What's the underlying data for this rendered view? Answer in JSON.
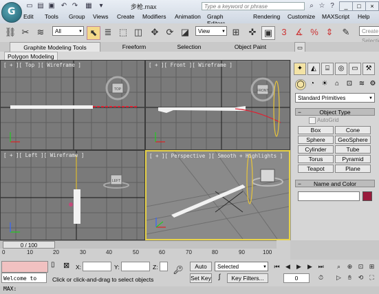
{
  "title_bar": {
    "logo_glyph": "G",
    "doc_title": "步枪.max",
    "search_placeholder": "Type a keyword or phrase",
    "quick_access": [
      "new-icon",
      "open-icon",
      "save-icon",
      "undo-icon",
      "redo-icon",
      "dropdown-icon"
    ],
    "right_icons": [
      "binoculars-icon",
      "star-icon",
      "help-icon"
    ],
    "window_buttons": [
      "_",
      "□",
      "×"
    ]
  },
  "menu": [
    "Edit",
    "Tools",
    "Group",
    "Views",
    "Create",
    "Modifiers",
    "Animation",
    "Graph Editors",
    "Rendering",
    "Customize",
    "MAXScript",
    "Help"
  ],
  "toolbar": {
    "selection_filter": "All",
    "coord_system": "View",
    "named_selection": "Create Selection Se"
  },
  "ribbon": {
    "tabs": [
      "Graphite Modeling Tools",
      "Freeform",
      "Selection",
      "Object Paint"
    ],
    "sub_tab": "Polygon Modeling"
  },
  "viewports": [
    {
      "label": "[ + ][ Top ][ Wireframe ]"
    },
    {
      "label": "[ + ][ Front ][ Wireframe ]"
    },
    {
      "label": "[ + ][ Left ][ Wireframe ]"
    },
    {
      "label": "[ + ][ Perspective ][ Smooth + Highlights ]"
    }
  ],
  "viewcube_labels": {
    "top": "TOP",
    "front": "FRONT",
    "left": "LEFT"
  },
  "command_panel": {
    "dropdown": "Standard Primitives",
    "object_type_title": "Object Type",
    "autogrid": "AutoGrid",
    "buttons": [
      "Box",
      "Cone",
      "Sphere",
      "GeoSphere",
      "Cylinder",
      "Tube",
      "Torus",
      "Pyramid",
      "Teapot",
      "Plane"
    ],
    "name_color_title": "Name and Color",
    "object_color": "#9a1b3c"
  },
  "timeline": {
    "frame_display": "0 / 100",
    "ticks": [
      "0",
      "10",
      "20",
      "30",
      "40",
      "50",
      "60",
      "70",
      "80",
      "90",
      "100"
    ]
  },
  "status": {
    "welcome": "Welcome to MAX:",
    "prompt": "Click or click-and-drag to select objects",
    "x_label": "X:",
    "y_label": "Y:",
    "z_label": "Z:",
    "auto_key": "Auto Key",
    "set_key": "Set Key",
    "key_mode": "Selected",
    "key_filters": "Key Filters...",
    "current_frame": "0"
  }
}
